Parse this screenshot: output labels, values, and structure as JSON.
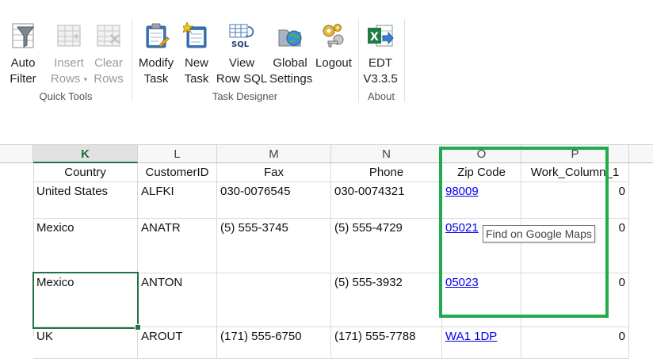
{
  "ribbon": {
    "groups": [
      {
        "label": "Quick Tools"
      },
      {
        "label": "Task Designer"
      },
      {
        "label": "About"
      }
    ],
    "buttons": {
      "auto_filter": {
        "line1": "Auto",
        "line2": "Filter",
        "icon": "funnel-icon"
      },
      "insert_rows": {
        "line1": "Insert",
        "line2": "Rows",
        "icon": "insert-rows-icon"
      },
      "clear_rows": {
        "line1": "Clear",
        "line2": "Rows",
        "icon": "clear-rows-icon"
      },
      "modify_task": {
        "line1": "Modify",
        "line2": "Task",
        "icon": "clipboard-edit-icon"
      },
      "new_task": {
        "line1": "New",
        "line2": "Task",
        "icon": "clipboard-new-icon"
      },
      "view_row_sql": {
        "line1": "View",
        "line2": "Row SQL",
        "icon": "sql-grid-icon",
        "icon_text": "SQL"
      },
      "global_settings": {
        "line1": "Global",
        "line2": "Settings",
        "icon": "globe-folder-icon"
      },
      "logout": {
        "line1": "Logout",
        "line2": "",
        "icon": "gears-key-icon"
      },
      "edt": {
        "line1": "EDT",
        "line2": "V3.3.5",
        "icon": "excel-arrow-icon",
        "icon_text": "X"
      }
    }
  },
  "grid": {
    "columns": [
      {
        "letter": "K",
        "header": "Country",
        "selected": true
      },
      {
        "letter": "L",
        "header": "CustomerID"
      },
      {
        "letter": "M",
        "header": "Fax"
      },
      {
        "letter": "N",
        "header": "Phone"
      },
      {
        "letter": "O",
        "header": "Zip Code"
      },
      {
        "letter": "P",
        "header": "Work_Column_1"
      }
    ],
    "rows": [
      {
        "country": "United States",
        "customer_id": "ALFKI",
        "fax": "030-0076545",
        "phone": "030-0074321",
        "zip": "98009",
        "work": "0"
      },
      {
        "country": "Mexico",
        "customer_id": "ANATR",
        "fax": "(5) 555-3745",
        "phone": "(5) 555-4729",
        "zip": "05021",
        "work": "0"
      },
      {
        "country": "Mexico",
        "customer_id": "ANTON",
        "fax": "",
        "phone": "(5) 555-3932",
        "zip": "05023",
        "work": "0"
      },
      {
        "country": "UK",
        "customer_id": "AROUT",
        "fax": "(171) 555-6750",
        "phone": "(171) 555-7788",
        "zip": "WA1 1DP",
        "work": "0"
      }
    ]
  },
  "tooltip": {
    "text": "Find on Google Maps"
  },
  "colors": {
    "highlight_border": "#22aa4f",
    "selection": "#217346",
    "link": "#0000ee"
  }
}
